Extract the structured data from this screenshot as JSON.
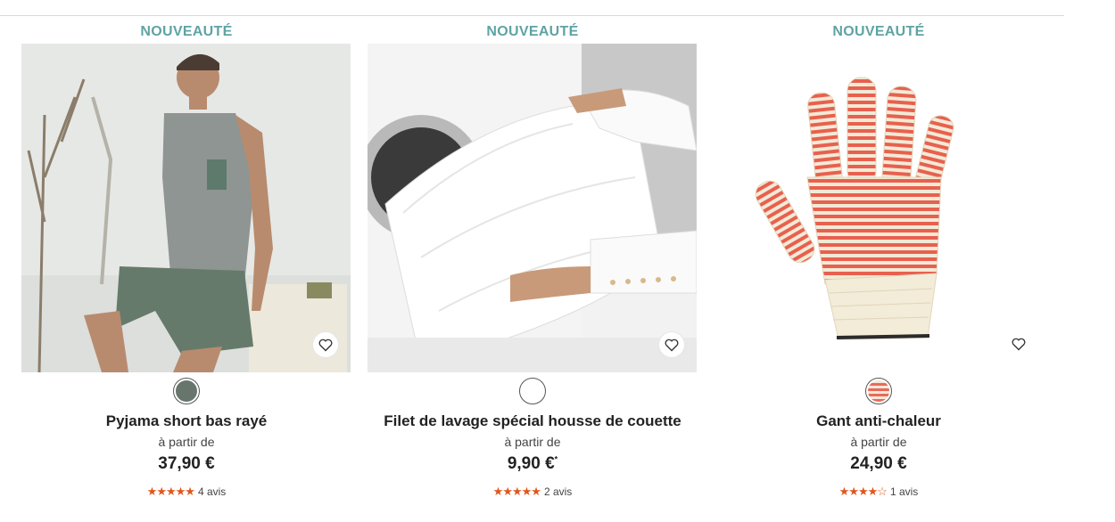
{
  "colors": {
    "badge": "#5fa3a3",
    "star": "#e0561c",
    "divider": "#d9d9d9"
  },
  "products": [
    {
      "badge": "NOUVEAUTÉ",
      "name": "Pyjama short bas rayé",
      "from_label": "à partir de",
      "price": "37,90 €",
      "price_note": "",
      "rating_stars": "★★★★★",
      "rating": 5,
      "reviews": "4 avis",
      "swatch_color": "#68756c",
      "image": "man-in-grey-pyjama-photo",
      "favorite_icon": "heart-outline-icon"
    },
    {
      "badge": "NOUVEAUTÉ",
      "name": "Filet de lavage spécial housse de couette",
      "from_label": "à partir de",
      "price": "9,90 €",
      "price_note": "*",
      "rating_stars": "★★★★★",
      "rating": 5,
      "reviews": "2 avis",
      "swatch_color": "#ffffff",
      "image": "washing-net-in-machine-photo",
      "favorite_icon": "heart-outline-icon"
    },
    {
      "badge": "NOUVEAUTÉ",
      "name": "Gant anti-chaleur",
      "from_label": "à partir de",
      "price": "24,90 €",
      "price_note": "",
      "rating_stars": "★★★★☆",
      "rating": 4,
      "reviews": "1 avis",
      "swatch_color": "#e86a5a",
      "image": "heat-resistant-glove-photo",
      "favorite_icon": "heart-outline-icon"
    }
  ]
}
